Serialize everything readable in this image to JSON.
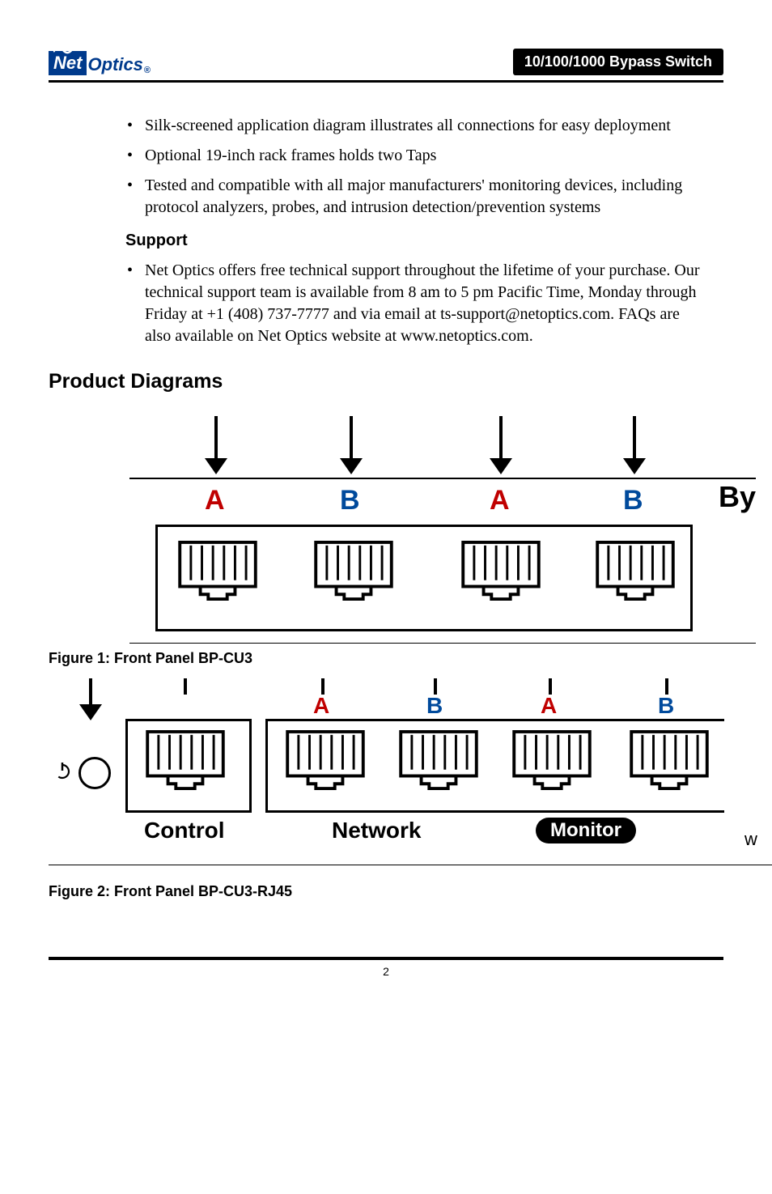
{
  "logo": {
    "net": "Net",
    "optics": "Optics",
    "reg": "®"
  },
  "header_title": "10/100/1000 Bypass Switch",
  "bullets_top": [
    "Silk-screened application diagram illustrates all connections for easy deployment",
    "Optional 19-inch rack frames holds two Taps",
    "Tested and compatible with all major manufacturers' monitoring devices, including protocol analyzers, probes, and intrusion detection/prevention systems"
  ],
  "support_heading": "Support",
  "support_bullet": "Net Optics offers free technical support throughout the lifetime of your purchase. Our technical support team is available from 8 am to 5 pm Pacific Time, Monday through Friday at +1 (408) 737-7777 and via email at ts-support@netoptics.com. FAQs are also available on Net Optics website at www.netoptics.com.",
  "product_diagrams_heading": "Product Diagrams",
  "diagram1": {
    "labels": {
      "a1": "A",
      "b1": "B",
      "a2": "A",
      "b2": "B",
      "by": "By"
    }
  },
  "figure1_prefix": "Figure 1: ",
  "figure1_caption": "Front Panel BP-CU3",
  "diagram2": {
    "labels": {
      "a1": "A",
      "b1": "B",
      "a2": "A",
      "b2": "B"
    },
    "control": "Control",
    "network": "Network",
    "monitor": "Monitor",
    "w": "w"
  },
  "figure2_prefix": "Figure 2: ",
  "figure2_caption": "Front Panel BP-CU3-RJ45",
  "page_number": "2"
}
